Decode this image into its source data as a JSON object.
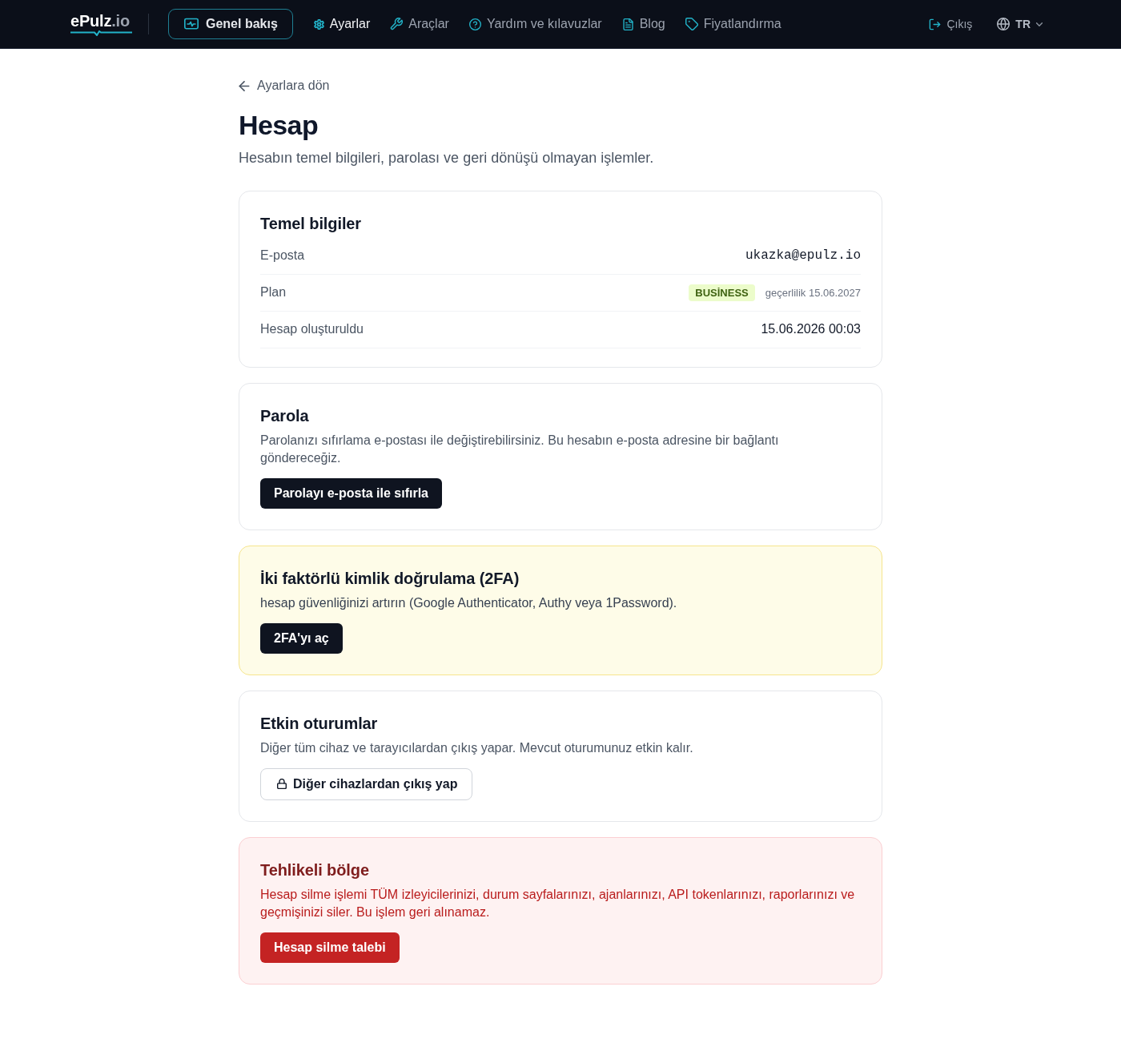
{
  "nav": {
    "logo": {
      "name": "ePulz",
      "suffix": ".io"
    },
    "overview_button": "Genel bakış",
    "links": [
      {
        "label": "Ayarlar",
        "selected": true
      },
      {
        "label": "Araçlar",
        "selected": false
      },
      {
        "label": "Yardım ve kılavuzlar",
        "selected": false
      },
      {
        "label": "Blog",
        "selected": false
      },
      {
        "label": "Fiyatlandırma",
        "selected": false
      }
    ],
    "logout": "Çıkış",
    "language": "TR"
  },
  "back_link": "Ayarlara dön",
  "title": "Hesap",
  "subtitle": "Hesabın temel bilgileri, parolası ve geri dönüşü olmayan işlemler.",
  "sections": [
    {
      "kind": "details",
      "title": "Temel bilgiler",
      "rows": [
        {
          "kind": "mono",
          "label": "E-posta",
          "value": "ukazka@epulz.io"
        },
        {
          "kind": "plan",
          "label": "Plan",
          "badge": "BUSİNESS",
          "value": "geçerlilik 15.06.2027"
        },
        {
          "kind": "text",
          "label": "Hesap oluşturuldu",
          "value": "15.06.2026 00:03"
        }
      ]
    },
    {
      "kind": "default",
      "title": "Parola",
      "text": "Parolanızı sıfırlama e-postası ile değiştirebilirsiniz. Bu hesabın e-posta adresine bir bağlantı göndereceğiz.",
      "button": {
        "kind": "primary",
        "label": "Parolayı e-posta ile sıfırla"
      }
    },
    {
      "kind": "warning",
      "title": "İki faktörlü kimlik doğrulama (2FA)",
      "text": "hesap güvenliğinizi artırın (Google Authenticator, Authy veya 1Password).",
      "button": {
        "kind": "primary",
        "label": "2FA'yı aç"
      }
    },
    {
      "kind": "default",
      "title": "Etkin oturumlar",
      "text": "Diğer tüm cihaz ve tarayıcılardan çıkış yapar. Mevcut oturumunuz etkin kalır.",
      "button": {
        "kind": "outline",
        "label": "Diğer cihazlardan çıkış yap"
      }
    },
    {
      "kind": "danger",
      "title": "Tehlikeli bölge",
      "text": "Hesap silme işlemi TÜM izleyicilerinizi, durum sayfalarınızı, ajanlarınızı, API tokenlarınızı, raporlarınızı ve geçmişinizi siler. Bu işlem geri alınamaz.",
      "button": {
        "kind": "danger",
        "label": "Hesap silme talebi"
      }
    }
  ]
}
